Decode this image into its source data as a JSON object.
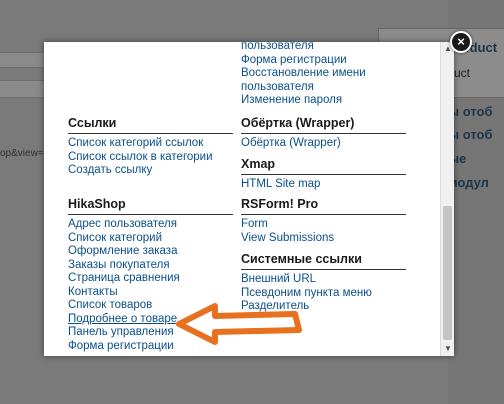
{
  "background": {
    "left_url_fragment": "op&view=",
    "right_header": "Product",
    "right_sub": "uct",
    "right_rows": [
      "ы отоб",
      "ы отоб",
      "ые",
      "модул"
    ]
  },
  "modal": {
    "close_icon": "close-icon",
    "left_sections": [
      {
        "title": "",
        "links": []
      },
      {
        "title": "Ссылки",
        "links": [
          "Список категорий ссылок",
          "Список ссылок в категории",
          "Создать ссылку"
        ]
      },
      {
        "title": "HikaShop",
        "links": [
          "Адрес пользователя",
          "Список категорий",
          "Оформление заказа",
          "Заказы покупателя",
          "Страница сравнения",
          "Контакты",
          "Список товаров",
          "Подробнее о товаре",
          "Панель управления",
          "Форма регистрации"
        ]
      }
    ],
    "right_top_links": [
      "пользователя",
      "Форма регистрации",
      "Восстановление имени пользователя",
      "Изменение пароля"
    ],
    "right_sections": [
      {
        "title": "Обёртка (Wrapper)",
        "links": [
          "Обёртка (Wrapper)"
        ]
      },
      {
        "title": "Xmap",
        "links": [
          "HTML Site map"
        ]
      },
      {
        "title": "RSForm! Pro",
        "links": [
          "Form",
          "View Submissions"
        ]
      },
      {
        "title": "Системные ссылки",
        "links": [
          "Внешний URL",
          "Псевдоним пункта меню",
          "Разделитель"
        ]
      }
    ],
    "scrollbar": {
      "up_icon": "scroll-up-arrow-icon",
      "down_icon": "scroll-down-arrow-icon"
    }
  },
  "annotation": {
    "arrow_color": "#e8701f",
    "points_to": "Подробнее о товаре"
  }
}
